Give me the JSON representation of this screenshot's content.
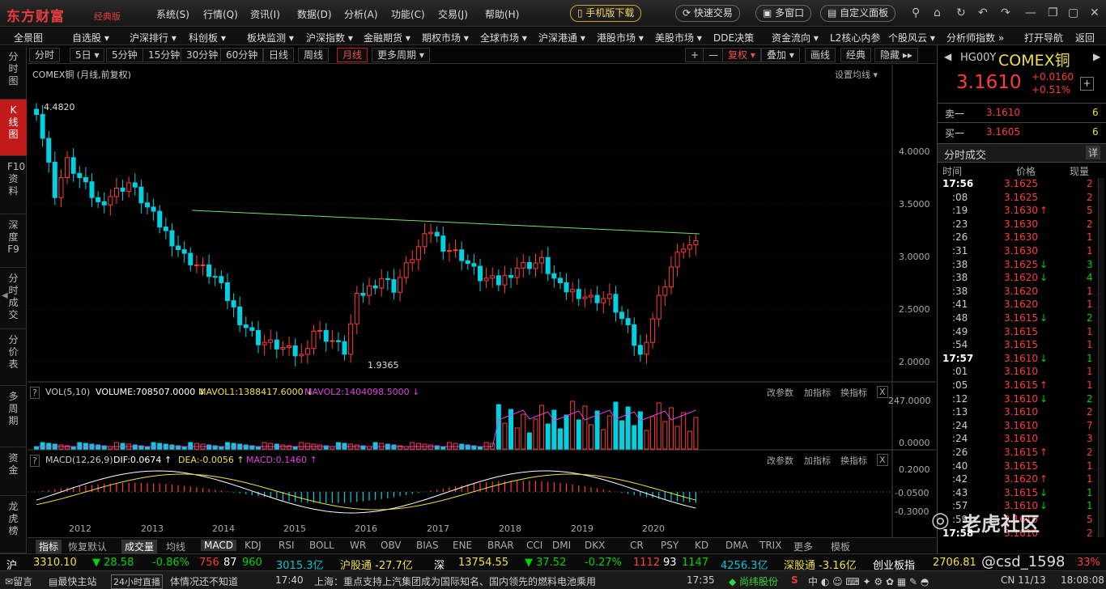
{
  "app": {
    "logo": "东方财富",
    "logo_sub": "经典版"
  },
  "menus": [
    "系统(S)",
    "行情(Q)",
    "资讯(I)",
    "数据(D)",
    "分析(A)",
    "功能(C)",
    "交易(J)",
    "帮助(H)"
  ],
  "title_buttons": {
    "mobile": "手机版下载",
    "quick_trade": "快速交易",
    "multi_window": "多窗口",
    "custom_panel": "自定义面板"
  },
  "nav": [
    "全景图",
    "自选股 ▾",
    "沪深排行 ▾",
    "科创板 ▾",
    "板块监测 ▾",
    "沪深指数 ▾",
    "金融期货 ▾",
    "期权市场 ▾",
    "全球市场 ▾",
    "沪深港通 ▾",
    "港股市场 ▾",
    "美股市场 ▾",
    "DDE决策",
    "资金流向 ▾",
    "L2核心内参",
    "个股风云 ▾",
    "分析师指数 »",
    "打开导航",
    "返回"
  ],
  "left_tabs": [
    "分时图",
    "K线图",
    "F10资料",
    "深度F9",
    "分时成交",
    "分价表",
    "多周期",
    "资金",
    "龙虎榜"
  ],
  "periods": [
    "分时",
    "5日 ▾",
    "5分钟",
    "15分钟",
    "30分钟",
    "60分钟",
    "日线",
    "周线",
    "月线",
    "更多周期 ▾"
  ],
  "toolbar_right": {
    "plus": "+",
    "minus": "—",
    "restore": "复权 ▾",
    "overlay": "叠加 ▾",
    "draw": "画线",
    "classic": "经典",
    "hide": "隐藏 ▸▸"
  },
  "main_chart": {
    "title": "COMEX铜 (月线,前复权)",
    "ma_setting": "设置均线 ▾",
    "high_label": "4.4820",
    "low_label": "1.9365",
    "y_ticks": [
      "4.0000",
      "3.5000",
      "3.0000",
      "2.5000",
      "2.0000"
    ],
    "years": [
      "2012",
      "2013",
      "2014",
      "2015",
      "2016",
      "2017",
      "2018",
      "2019",
      "2020"
    ]
  },
  "vol_panel": {
    "q": "?",
    "text1": "VOL(5,10)",
    "text2": "VOLUME:708507.0000 ↓",
    "mavol1": "MAVOL1:1388417.6000 ↓",
    "mavol2": "MAVOL2:1404098.5000 ↓",
    "y_ticks": [
      "247.0000",
      "0.0000"
    ]
  },
  "macd_panel": {
    "q": "?",
    "text1": "MACD(12,26,9)",
    "dif": "DIF:0.0674 ↑",
    "dea": "DEA:-0.0056 ↑",
    "macd": "MACD:0.1460 ↑",
    "y_ticks": [
      "0.2000",
      "-0.0500",
      "-0.3000"
    ]
  },
  "panel_buttons": {
    "params": "改参数",
    "add": "加指标",
    "swap": "换指标",
    "close": "X"
  },
  "quote": {
    "code": "HG00Y",
    "name": "COMEX铜",
    "price": "3.1610",
    "change": "+0.0160",
    "pct": "+0.51%",
    "sell_label": "卖一",
    "sell_price": "3.1610",
    "sell_vol": "6",
    "buy_label": "买一",
    "buy_price": "3.1605",
    "buy_vol": "6",
    "ticks_title": "分时成交",
    "detail": "详",
    "col_time": "时间",
    "col_price": "价格",
    "col_vol": "现量"
  },
  "ticks": [
    {
      "t": "17:56",
      "p": "3.1625",
      "a": "",
      "v": "2"
    },
    {
      "t": ":08",
      "p": "3.1625",
      "a": "",
      "v": "2"
    },
    {
      "t": ":19",
      "p": "3.1630",
      "a": "↑",
      "v": "5"
    },
    {
      "t": ":23",
      "p": "3.1630",
      "a": "",
      "v": "2"
    },
    {
      "t": ":26",
      "p": "3.1630",
      "a": "",
      "v": "1"
    },
    {
      "t": ":31",
      "p": "3.1630",
      "a": "",
      "v": "1"
    },
    {
      "t": ":38",
      "p": "3.1625",
      "a": "↓",
      "v": "3"
    },
    {
      "t": ":38",
      "p": "3.1620",
      "a": "↓",
      "v": "4"
    },
    {
      "t": ":38",
      "p": "3.1620",
      "a": "",
      "v": "1"
    },
    {
      "t": ":41",
      "p": "3.1620",
      "a": "",
      "v": "1"
    },
    {
      "t": ":48",
      "p": "3.1615",
      "a": "↓",
      "v": "2"
    },
    {
      "t": ":49",
      "p": "3.1615",
      "a": "",
      "v": "1"
    },
    {
      "t": ":54",
      "p": "3.1615",
      "a": "",
      "v": "1"
    },
    {
      "t": "17:57",
      "p": "3.1610",
      "a": "↓",
      "v": "1"
    },
    {
      "t": ":01",
      "p": "3.1610",
      "a": "",
      "v": "1"
    },
    {
      "t": ":05",
      "p": "3.1615",
      "a": "↑",
      "v": "1"
    },
    {
      "t": ":12",
      "p": "3.1610",
      "a": "↓",
      "v": "2"
    },
    {
      "t": ":13",
      "p": "3.1610",
      "a": "",
      "v": "2"
    },
    {
      "t": ":24",
      "p": "3.1610",
      "a": "",
      "v": "7"
    },
    {
      "t": ":24",
      "p": "3.1610",
      "a": "",
      "v": "3"
    },
    {
      "t": ":26",
      "p": "3.1615",
      "a": "↑",
      "v": "2"
    },
    {
      "t": ":40",
      "p": "3.1615",
      "a": "",
      "v": "1"
    },
    {
      "t": ":42",
      "p": "3.1620",
      "a": "↑",
      "v": "1"
    },
    {
      "t": ":43",
      "p": "3.1615",
      "a": "↓",
      "v": "1"
    },
    {
      "t": ":57",
      "p": "3.1610",
      "a": "↓",
      "v": "1"
    },
    {
      "t": ":59",
      "p": "3.1610",
      "a": "",
      "v": "5"
    },
    {
      "t": "17:58",
      "p": "3.1610",
      "a": "",
      "v": "2"
    }
  ],
  "indicator_tabs": [
    "指标",
    "恢复默认",
    "成交量",
    "均线",
    "MACD",
    "KDJ",
    "RSI",
    "BOLL",
    "WR",
    "OBV",
    "BIAS",
    "ENE",
    "BRAR",
    "CCI",
    "DMI",
    "DKX",
    "CR",
    "PSY",
    "KD",
    "DMA",
    "TRIX",
    "更多",
    "模板"
  ],
  "index_bar": {
    "sh_label": "沪",
    "sh_val": "3310.10",
    "sh_chg": "▼ 28.58",
    "sh_pct": "-0.86%",
    "sh_n1": "756",
    "sh_n2": "87",
    "sh_n3": "960",
    "sh_amt": "3015.3亿",
    "hgt": "沪股通 -27.7亿",
    "sz_label": "深",
    "sz_val": "13754.55",
    "sz_chg": "▼ 37.52",
    "sz_pct": "-0.27%",
    "sz_n1": "1112",
    "sz_n2": "93",
    "sz_n3": "1147",
    "sz_amt": "4256.3亿",
    "sgt": "深股通 -3.16亿",
    "cyb": "创业板指",
    "cyb_val": "2706.81",
    "cyb_pct": "33%"
  },
  "status_bar": {
    "msg": "留言",
    "host": "最快主站",
    "live": "24小时直播",
    "news1": "体情况还不知道",
    "time1": "17:40",
    "news2": "上海：重点支持上汽集团成为国际知名、国内领先的燃料电池乘用",
    "time2": "17:35",
    "stock": "◆ 尚纬股份",
    "date": "CN 11/13",
    "clock": "18:08:08"
  },
  "watermark": "老虎社区",
  "watermark_user": "@csd_1598"
}
